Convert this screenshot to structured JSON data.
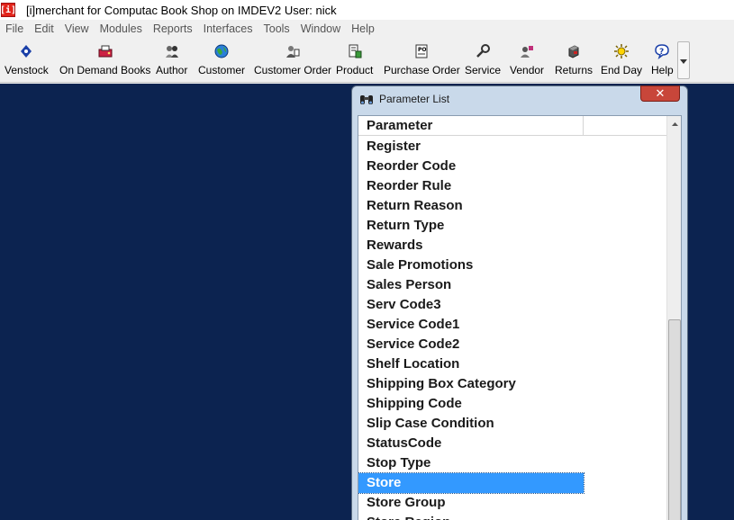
{
  "window": {
    "title": "[i]merchant for Computac Book Shop on IMDEV2 User: nick",
    "app_icon_text": "[i]"
  },
  "menu": [
    "File",
    "Edit",
    "View",
    "Modules",
    "Reports",
    "Interfaces",
    "Tools",
    "Window",
    "Help"
  ],
  "toolbar": [
    {
      "label": "Venstock",
      "icon": "venstock-icon"
    },
    {
      "label": "On Demand Books",
      "icon": "on-demand-books-icon"
    },
    {
      "label": "Author",
      "icon": "author-icon"
    },
    {
      "label": "Customer",
      "icon": "globe-icon"
    },
    {
      "label": "Customer Order",
      "icon": "customer-order-icon"
    },
    {
      "label": "Product",
      "icon": "product-icon"
    },
    {
      "label": "Purchase Order",
      "icon": "purchase-order-icon"
    },
    {
      "label": "Service",
      "icon": "wrench-icon"
    },
    {
      "label": "Vendor",
      "icon": "vendor-icon"
    },
    {
      "label": "Returns",
      "icon": "returns-icon"
    },
    {
      "label": "End Day",
      "icon": "sun-icon"
    },
    {
      "label": "Help",
      "icon": "help-icon"
    }
  ],
  "dialog": {
    "title": "Parameter List",
    "close_glyph": "✕",
    "column_header": "Parameter",
    "rows": [
      "Register",
      "Reorder Code",
      "Reorder Rule",
      "Return Reason",
      "Return Type",
      "Rewards",
      "Sale Promotions",
      "Sales Person",
      "Serv Code3",
      "Service Code1",
      "Service Code2",
      "Shelf Location",
      "Shipping Box Category",
      "Shipping Code",
      "Slip Case Condition",
      "StatusCode",
      "Stop Type",
      "Store",
      "Store Group",
      "Store Region"
    ],
    "selected_row": "Store"
  },
  "colors": {
    "workspace": "#0c2350",
    "selection": "#3399ff",
    "close_button": "#c8463a"
  }
}
